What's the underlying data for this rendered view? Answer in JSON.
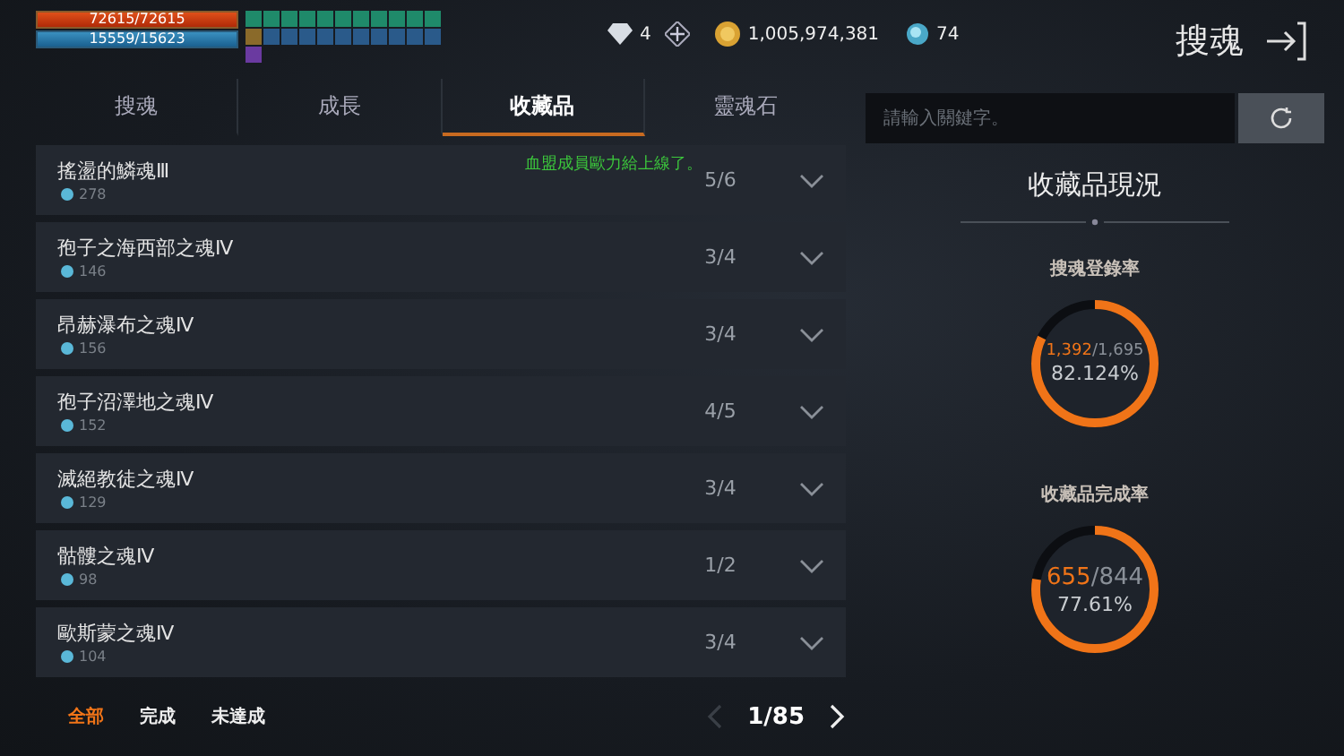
{
  "player": {
    "hp": {
      "text": "72615/72615",
      "level": 1
    },
    "mp": {
      "text": "15559/15623",
      "level": 0.996
    }
  },
  "currencies": [
    {
      "kind": "diamond",
      "amount": "4",
      "addable": true
    },
    {
      "kind": "coin",
      "amount": "1,005,974,381",
      "addable": false
    },
    {
      "kind": "gem",
      "amount": "74",
      "addable": false
    }
  ],
  "title": "搜魂",
  "tabs": [
    {
      "label": "搜魂",
      "selected": false
    },
    {
      "label": "成長",
      "selected": false
    },
    {
      "label": "收藏品",
      "selected": true
    },
    {
      "label": "靈魂石",
      "selected": false
    }
  ],
  "search": {
    "placeholder": "請輸入關鍵字。"
  },
  "notification": "血盟成員歐力給上線了。",
  "rows": [
    {
      "name": "搖盪的鱗魂Ⅲ",
      "points": "278",
      "count": "5/6"
    },
    {
      "name": "孢子之海西部之魂Ⅳ",
      "points": "146",
      "count": "3/4"
    },
    {
      "name": "昂赫瀑布之魂Ⅳ",
      "points": "156",
      "count": "3/4"
    },
    {
      "name": "孢子沼澤地之魂Ⅳ",
      "points": "152",
      "count": "4/5"
    },
    {
      "name": "滅絕教徒之魂Ⅳ",
      "points": "129",
      "count": "3/4"
    },
    {
      "name": "骷髏之魂Ⅳ",
      "points": "98",
      "count": "1/2"
    },
    {
      "name": "歐斯蒙之魂Ⅳ",
      "points": "104",
      "count": "3/4"
    }
  ],
  "filters": [
    {
      "label": "全部",
      "selected": true
    },
    {
      "label": "完成",
      "selected": false
    },
    {
      "label": "未達成",
      "selected": false
    }
  ],
  "pager": {
    "text": "1/85",
    "prev_disabled": true,
    "next_disabled": false
  },
  "summary": {
    "title": "收藏品現況",
    "stats": [
      {
        "label": "搜魂登錄率",
        "current": "1,392",
        "total": "/1,695",
        "percent": "82.124%",
        "level": 0.82124
      },
      {
        "label": "收藏品完成率",
        "current": "655",
        "total": "/844",
        "percent": "77.61%",
        "level": 0.7761
      }
    ]
  }
}
